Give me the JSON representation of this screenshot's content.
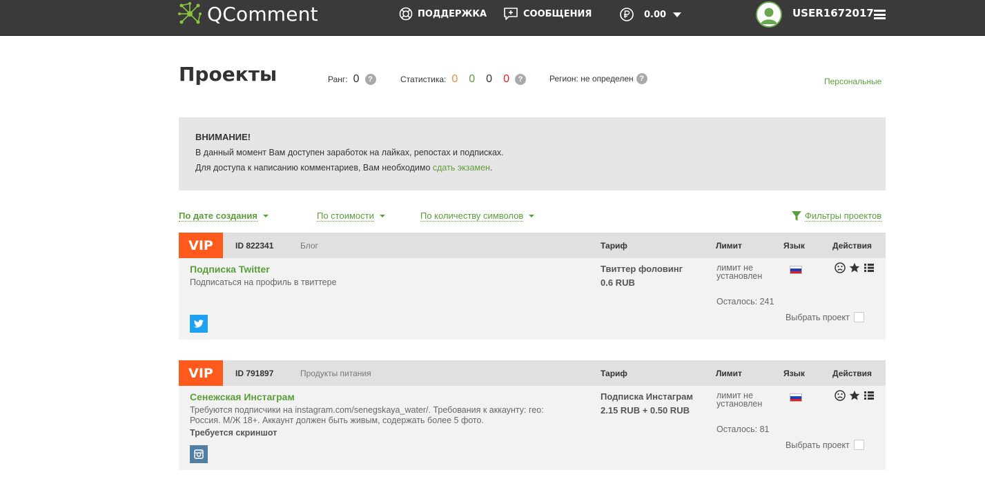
{
  "header": {
    "logo_text": "QComment",
    "nav": {
      "support": "ПОДДЕРЖКА",
      "messages": "СООБЩЕНИЯ",
      "balance": "0.00"
    },
    "username": "USER1672017"
  },
  "page": {
    "title": "Проекты",
    "rank_label": "Ранг:",
    "rank_value": "0",
    "stats_label": "Статистика:",
    "stats_values": [
      "0",
      "0",
      "0",
      "0"
    ],
    "region_label": "Регион: не определен",
    "personal_link": "Персональные",
    "help_icon": "?"
  },
  "notice": {
    "title": "ВНИМАНИЕ!",
    "line1": "В данный момент Вам доступен заработок на лайках, репостах и подписках.",
    "line2_prefix": "Для доступа к написанию комментариев, Вам необходимо ",
    "line2_link": "сдать экзамен",
    "line2_suffix": "."
  },
  "sorting": {
    "by_date": "По дате создания",
    "by_cost": "По стоимости",
    "by_symbols": "По количеству символов",
    "filters": "Фильтры проектов"
  },
  "columns": {
    "tariff": "Тариф",
    "limit": "Лимит",
    "language": "Язык",
    "actions": "Действия"
  },
  "projects": [
    {
      "badge": "VIP",
      "id": "ID 822341",
      "category": "Блог",
      "title": "Подписка Twitter",
      "description": "Подписаться на профиль в твиттере",
      "requirement": "",
      "tariff_name": "Твиттер фоловинг",
      "tariff_price": "0.6 RUB",
      "limit": "лимит не установлен",
      "remaining": "Осталось: 241",
      "select_label": "Выбрать проект",
      "social": "twitter"
    },
    {
      "badge": "VIP",
      "id": "ID 791897",
      "category": "Продукты питания",
      "title": "Сенежская Инстаграм",
      "description": "Требуются подписчики на instagram.com/senegskaya_water/. Требования к аккаунту: гео: Россия. М/Ж 18+. Аккаунт должен быть живым, содержать более 5 фото.",
      "requirement": "Требуется скриншот",
      "tariff_name": "Подписка Инстаграм",
      "tariff_price": "2.15 RUB + 0.50 RUB",
      "limit": "лимит не установлен",
      "remaining": "Осталось: 81",
      "select_label": "Выбрать проект",
      "social": "instagram"
    }
  ],
  "colors": {
    "topbar": "#3a3a3a",
    "accent_green": "#5a9e3a",
    "vip_orange": "#ff5a1e",
    "stat_orange": "#f08c3c",
    "stat_red": "#e02020",
    "twitter_blue": "#1da1f2",
    "instagram_blue": "#517fa4"
  }
}
